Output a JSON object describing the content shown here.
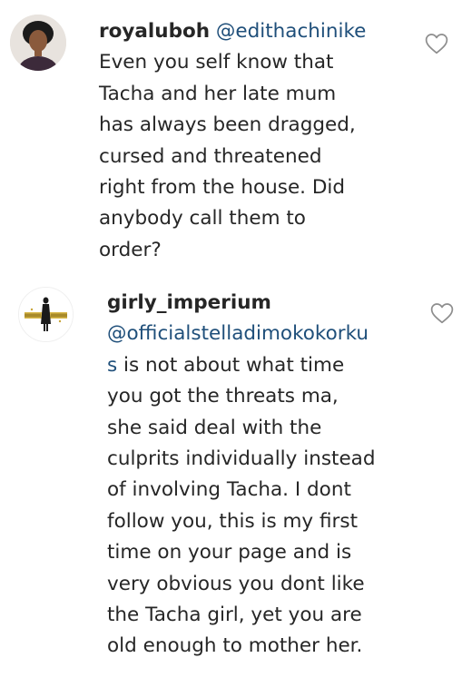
{
  "comments": [
    {
      "username": "royaluboh",
      "mention_inline": "@edithachinike",
      "lines": [
        "Even you self know that",
        "Tacha and her late mum",
        "has always been dragged,",
        "cursed and threatened",
        "right from the house. Did",
        "anybody call them to",
        "order?"
      ],
      "like_icon": "heart-outline-icon"
    },
    {
      "username": "girly_imperium",
      "mention_line1": "@officialstelladimokokorku",
      "mention_line2": "s",
      "line2_rest": " is not about what time",
      "lines": [
        "you got the threats ma,",
        "she said deal with the",
        "culprits individually instead",
        "of involving Tacha. I dont",
        "follow you, this is my first",
        "time on your page and is",
        "very obvious you dont like",
        "the Tacha girl, yet you are",
        "old enough to mother her."
      ],
      "like_icon": "heart-outline-icon"
    }
  ]
}
